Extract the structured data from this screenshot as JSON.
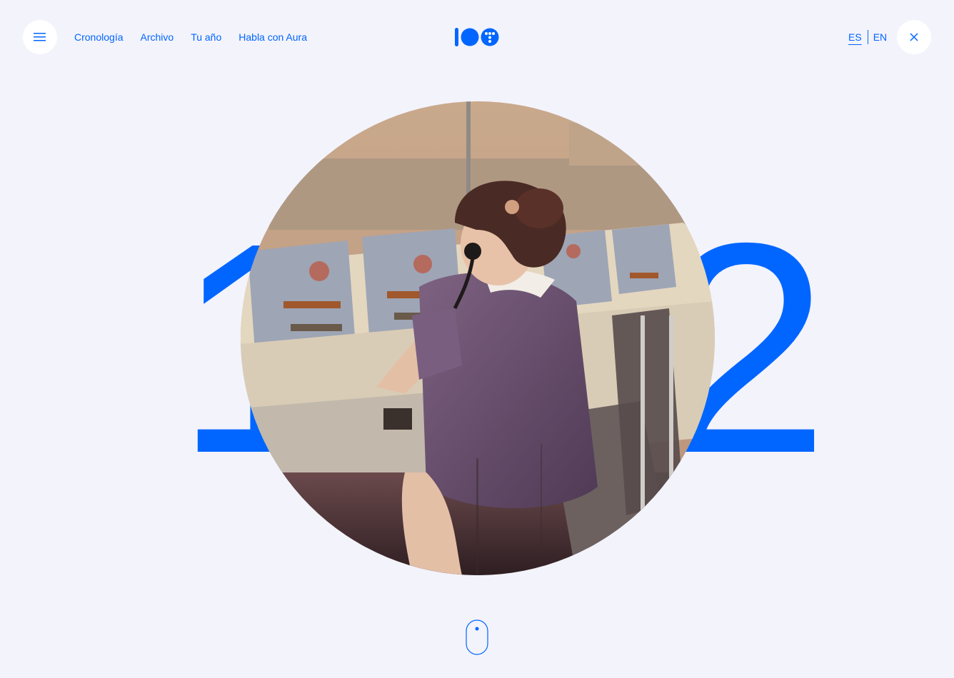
{
  "header": {
    "menu_icon": "hamburger-icon",
    "close_icon": "close-icon",
    "logo_icon": "centenary-100-logo",
    "nav": [
      {
        "label": "Cronología"
      },
      {
        "label": "Archivo"
      },
      {
        "label": "Tu año"
      },
      {
        "label": "Habla con Aura"
      }
    ],
    "lang": {
      "es": "ES",
      "en": "EN",
      "active": "ES"
    }
  },
  "hero": {
    "year": "1972",
    "photo_description_icon": "vintage-operator-photo",
    "scroll_icon": "mouse-scroll-icon"
  },
  "colors": {
    "accent": "#0066ff",
    "background": "#f3f3fc"
  }
}
